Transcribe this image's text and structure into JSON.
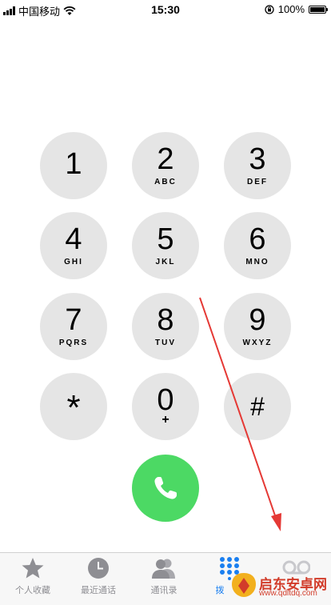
{
  "status": {
    "carrier": "中国移动",
    "time": "15:30",
    "battery": "100%"
  },
  "keypad": [
    {
      "digit": "1",
      "letters": ""
    },
    {
      "digit": "2",
      "letters": "ABC"
    },
    {
      "digit": "3",
      "letters": "DEF"
    },
    {
      "digit": "4",
      "letters": "GHI"
    },
    {
      "digit": "5",
      "letters": "JKL"
    },
    {
      "digit": "6",
      "letters": "MNO"
    },
    {
      "digit": "7",
      "letters": "PQRS"
    },
    {
      "digit": "8",
      "letters": "TUV"
    },
    {
      "digit": "9",
      "letters": "WXYZ"
    },
    {
      "digit": "*",
      "letters": ""
    },
    {
      "digit": "0",
      "letters": "+"
    },
    {
      "digit": "#",
      "letters": ""
    }
  ],
  "tabs": [
    {
      "label": "个人收藏",
      "icon": "star-icon"
    },
    {
      "label": "最近通话",
      "icon": "clock-icon"
    },
    {
      "label": "通讯录",
      "icon": "contacts-icon"
    },
    {
      "label": "拨",
      "icon": "keypad-icon"
    },
    {
      "label": "",
      "icon": "voicemail-icon"
    }
  ],
  "watermark": {
    "name": "启东安卓网",
    "url": "www.qdltdq.com"
  },
  "colors": {
    "key_bg": "#e5e5e5",
    "call_green": "#4cd964",
    "tab_active": "#1a7ff0",
    "annotation_red": "#e53935"
  }
}
